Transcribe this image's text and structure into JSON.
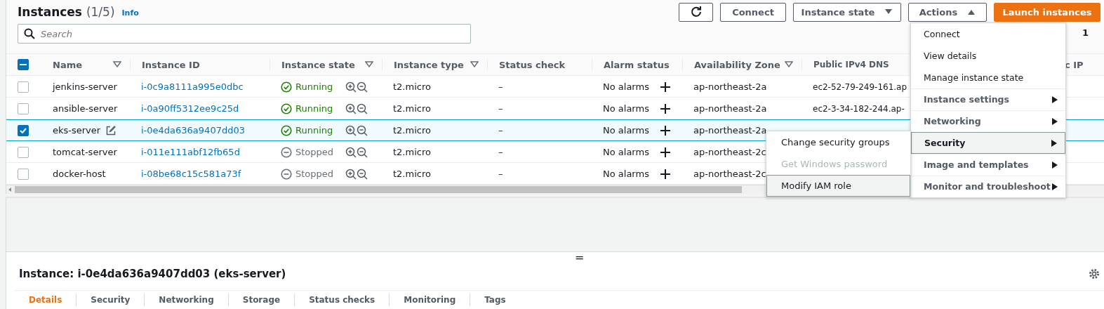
{
  "header": {
    "title": "Instances",
    "count": "(1/5)",
    "info": "Info"
  },
  "buttons": [
    {
      "kind": "refresh"
    },
    {
      "kind": "plain",
      "label": "Connect"
    },
    {
      "kind": "dropdown",
      "label": "Instance state",
      "expanded": false
    },
    {
      "kind": "dropdown",
      "label": "Actions",
      "expanded": true
    },
    {
      "kind": "primary",
      "label": "Launch instances"
    }
  ],
  "search": {
    "placeholder": "Search"
  },
  "pagination": {
    "page": "1"
  },
  "table": {
    "select_all": {
      "indeterminate": true
    },
    "columns": [
      {
        "label": "Name",
        "sortable": true
      },
      {
        "label": "Instance ID",
        "sortable": false
      },
      {
        "label": "Instance state",
        "sortable": true
      },
      {
        "label": "Instance type",
        "sortable": true
      },
      {
        "label": "Status check",
        "sortable": false
      },
      {
        "label": "Alarm status",
        "sortable": false
      },
      {
        "label": "Availability Zone",
        "sortable": true
      },
      {
        "label": "Public IPv4 DNS",
        "sortable": false
      },
      {
        "label": "c IP",
        "sortable": false
      }
    ],
    "rows": [
      {
        "checked": false,
        "name": "jenkins-server",
        "edit_icon": false,
        "id": "i-0c9a8111a995e0dbc",
        "state": "Running",
        "kind": "running",
        "type": "t2.micro",
        "status_check": "–",
        "alarm": "No alarms",
        "zone": "ap-northeast-2a",
        "dns": "ec2-52-79-249-161.ap"
      },
      {
        "checked": false,
        "name": "ansible-server",
        "edit_icon": false,
        "id": "i-0a90ff5312ee9c25d",
        "state": "Running",
        "kind": "running",
        "type": "t2.micro",
        "status_check": "–",
        "alarm": "No alarms",
        "zone": "ap-northeast-2a",
        "dns": "ec2-3-34-182-244.ap-"
      },
      {
        "checked": true,
        "name": "eks-server",
        "edit_icon": true,
        "id": "i-0e4da636a9407dd03",
        "state": "Running",
        "kind": "running",
        "type": "t2.micro",
        "status_check": "–",
        "alarm": "No alarms",
        "zone": "ap-northeast-2a"
      },
      {
        "checked": false,
        "name": "tomcat-server",
        "edit_icon": false,
        "id": "i-011e111abf12fb65d",
        "state": "Stopped",
        "kind": "stopped",
        "type": "t2.micro",
        "status_check": "–",
        "alarm": "No alarms",
        "zone": "ap-northeast-2c"
      },
      {
        "checked": false,
        "name": "docker-host",
        "edit_icon": false,
        "id": "i-08be68c15c581a73f",
        "state": "Stopped",
        "kind": "stopped",
        "type": "t2.micro",
        "status_check": "–",
        "alarm": "No alarms",
        "zone": "ap-northeast-2c"
      }
    ]
  },
  "actions_menu": [
    {
      "kind": "action",
      "label": "Connect",
      "selected": false
    },
    {
      "kind": "action",
      "label": "View details",
      "selected": false
    },
    {
      "kind": "action",
      "label": "Manage instance state",
      "selected": false
    },
    {
      "kind": "submenu",
      "label": "Instance settings",
      "selected": false
    },
    {
      "kind": "submenu",
      "label": "Networking",
      "selected": false
    },
    {
      "kind": "submenu",
      "label": "Security",
      "selected": true
    },
    {
      "kind": "submenu",
      "label": "Image and templates",
      "selected": false
    },
    {
      "kind": "submenu",
      "label": "Monitor and troubleshoot",
      "selected": false
    }
  ],
  "security_submenu": [
    {
      "label": "Change security groups",
      "disabled": false,
      "selected": false
    },
    {
      "label": "Get Windows password",
      "disabled": true,
      "selected": false
    },
    {
      "label": "Modify IAM role",
      "disabled": false,
      "selected": true
    }
  ],
  "detail_panel": {
    "resize_handle": "=",
    "title": "Instance: i-0e4da636a9407dd03 (eks-server)",
    "tabs": [
      {
        "label": "Details",
        "selected": true
      },
      {
        "label": "Security",
        "selected": false
      },
      {
        "label": "Networking",
        "selected": false
      },
      {
        "label": "Storage",
        "selected": false
      },
      {
        "label": "Status checks",
        "selected": false
      },
      {
        "label": "Monitoring",
        "selected": false
      },
      {
        "label": "Tags",
        "selected": false
      }
    ]
  }
}
